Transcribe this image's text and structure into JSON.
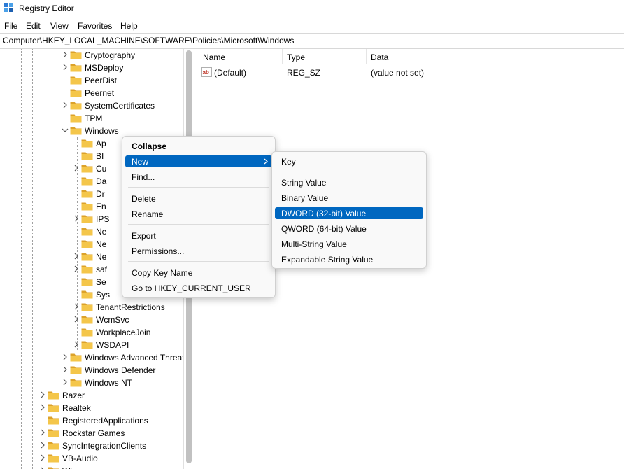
{
  "window": {
    "title": "Registry Editor"
  },
  "menu": [
    "File",
    "Edit",
    "View",
    "Favorites",
    "Help"
  ],
  "address": "Computer\\HKEY_LOCAL_MACHINE\\SOFTWARE\\Policies\\Microsoft\\Windows",
  "tree": {
    "microsoft_children": [
      {
        "label": "Cryptography",
        "expandable": true
      },
      {
        "label": "MSDeploy",
        "expandable": true
      },
      {
        "label": "PeerDist",
        "expandable": false
      },
      {
        "label": "Peernet",
        "expandable": false
      },
      {
        "label": "SystemCertificates",
        "expandable": true
      },
      {
        "label": "TPM",
        "expandable": false
      },
      {
        "label": "Windows",
        "expandable": true,
        "expanded": true
      }
    ],
    "windows_children": [
      {
        "label": "Ap",
        "expandable": false
      },
      {
        "label": "BI",
        "expandable": false
      },
      {
        "label": "Cu",
        "expandable": true
      },
      {
        "label": "Da",
        "expandable": false
      },
      {
        "label": "Dr",
        "expandable": false
      },
      {
        "label": "En",
        "expandable": false
      },
      {
        "label": "IPS",
        "expandable": true
      },
      {
        "label": "Ne",
        "expandable": false
      },
      {
        "label": "Ne",
        "expandable": false
      },
      {
        "label": "Ne",
        "expandable": true
      },
      {
        "label": "saf",
        "expandable": true
      },
      {
        "label": "Se",
        "expandable": false
      },
      {
        "label": "Sys",
        "expandable": false
      },
      {
        "label": "TenantRestrictions",
        "expandable": true
      },
      {
        "label": "WcmSvc",
        "expandable": true
      },
      {
        "label": "WorkplaceJoin",
        "expandable": false
      },
      {
        "label": "WSDAPI",
        "expandable": true
      }
    ],
    "microsoft_after": [
      {
        "label": "Windows Advanced Threat Protection",
        "expandable": true
      },
      {
        "label": "Windows Defender",
        "expandable": true
      },
      {
        "label": "Windows NT",
        "expandable": true
      }
    ],
    "policies_after": [
      {
        "label": "Razer",
        "expandable": true
      },
      {
        "label": "Realtek",
        "expandable": true
      },
      {
        "label": "RegisteredApplications",
        "expandable": false
      },
      {
        "label": "Rockstar Games",
        "expandable": true
      },
      {
        "label": "SyncIntegrationClients",
        "expandable": true
      },
      {
        "label": "VB-Audio",
        "expandable": true
      },
      {
        "label": "Wi",
        "expandable": true
      }
    ]
  },
  "values_pane": {
    "columns": [
      "Name",
      "Type",
      "Data"
    ],
    "rows": [
      {
        "name": "(Default)",
        "type": "REG_SZ",
        "data": "(value not set)",
        "icon": "string-value-icon"
      }
    ]
  },
  "context_menu": {
    "items": [
      "Collapse",
      "New",
      "Find...",
      "Delete",
      "Rename",
      "Export",
      "Permissions...",
      "Copy Key Name",
      "Go to HKEY_CURRENT_USER"
    ],
    "highlighted": "New"
  },
  "submenu": {
    "items": [
      "Key",
      "String Value",
      "Binary Value",
      "DWORD (32-bit) Value",
      "QWORD (64-bit) Value",
      "Multi-String Value",
      "Expandable String Value"
    ],
    "highlighted": "DWORD (32-bit) Value"
  },
  "colors": {
    "highlight": "#0067c0",
    "folder": "#f4c64a",
    "folder_dark": "#dca22a"
  }
}
